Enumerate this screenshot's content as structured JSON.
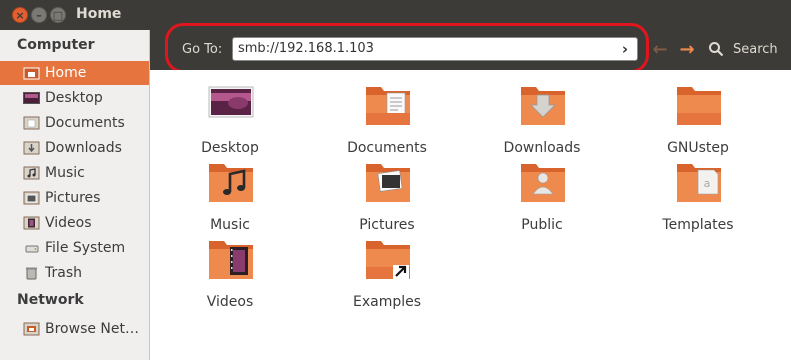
{
  "window": {
    "title": "Home",
    "close_glyph": "×",
    "min_glyph": "–",
    "max_glyph": "□"
  },
  "toolbar": {
    "goto_label": "Go To:",
    "location_value": "smb://192.168.1.103",
    "go_glyph": "›",
    "back_glyph": "←",
    "forward_glyph": "→",
    "search_label": "Search"
  },
  "sidebar": {
    "computer_heading": "Computer",
    "network_heading": "Network",
    "items": [
      {
        "label": "Home",
        "icon": "home-icon"
      },
      {
        "label": "Desktop",
        "icon": "desktop-icon"
      },
      {
        "label": "Documents",
        "icon": "documents-icon"
      },
      {
        "label": "Downloads",
        "icon": "downloads-icon"
      },
      {
        "label": "Music",
        "icon": "music-icon"
      },
      {
        "label": "Pictures",
        "icon": "pictures-icon"
      },
      {
        "label": "Videos",
        "icon": "videos-icon"
      },
      {
        "label": "File System",
        "icon": "filesystem-icon"
      },
      {
        "label": "Trash",
        "icon": "trash-icon"
      }
    ],
    "network_items": [
      {
        "label": "Browse Net…",
        "icon": "network-icon"
      }
    ]
  },
  "content": {
    "items": [
      {
        "label": "Desktop",
        "icon": "desktop-icon"
      },
      {
        "label": "Documents",
        "icon": "documents-folder-icon"
      },
      {
        "label": "Downloads",
        "icon": "downloads-folder-icon"
      },
      {
        "label": "GNUstep",
        "icon": "folder-icon"
      },
      {
        "label": "Music",
        "icon": "music-folder-icon"
      },
      {
        "label": "Pictures",
        "icon": "pictures-folder-icon"
      },
      {
        "label": "Public",
        "icon": "public-folder-icon"
      },
      {
        "label": "Templates",
        "icon": "templates-folder-icon"
      },
      {
        "label": "Videos",
        "icon": "videos-folder-icon"
      },
      {
        "label": "Examples",
        "icon": "examples-link-icon"
      }
    ]
  },
  "colors": {
    "accent": "#e5743f",
    "highlight_ring": "#e0161f",
    "chrome": "#3c3b37"
  }
}
